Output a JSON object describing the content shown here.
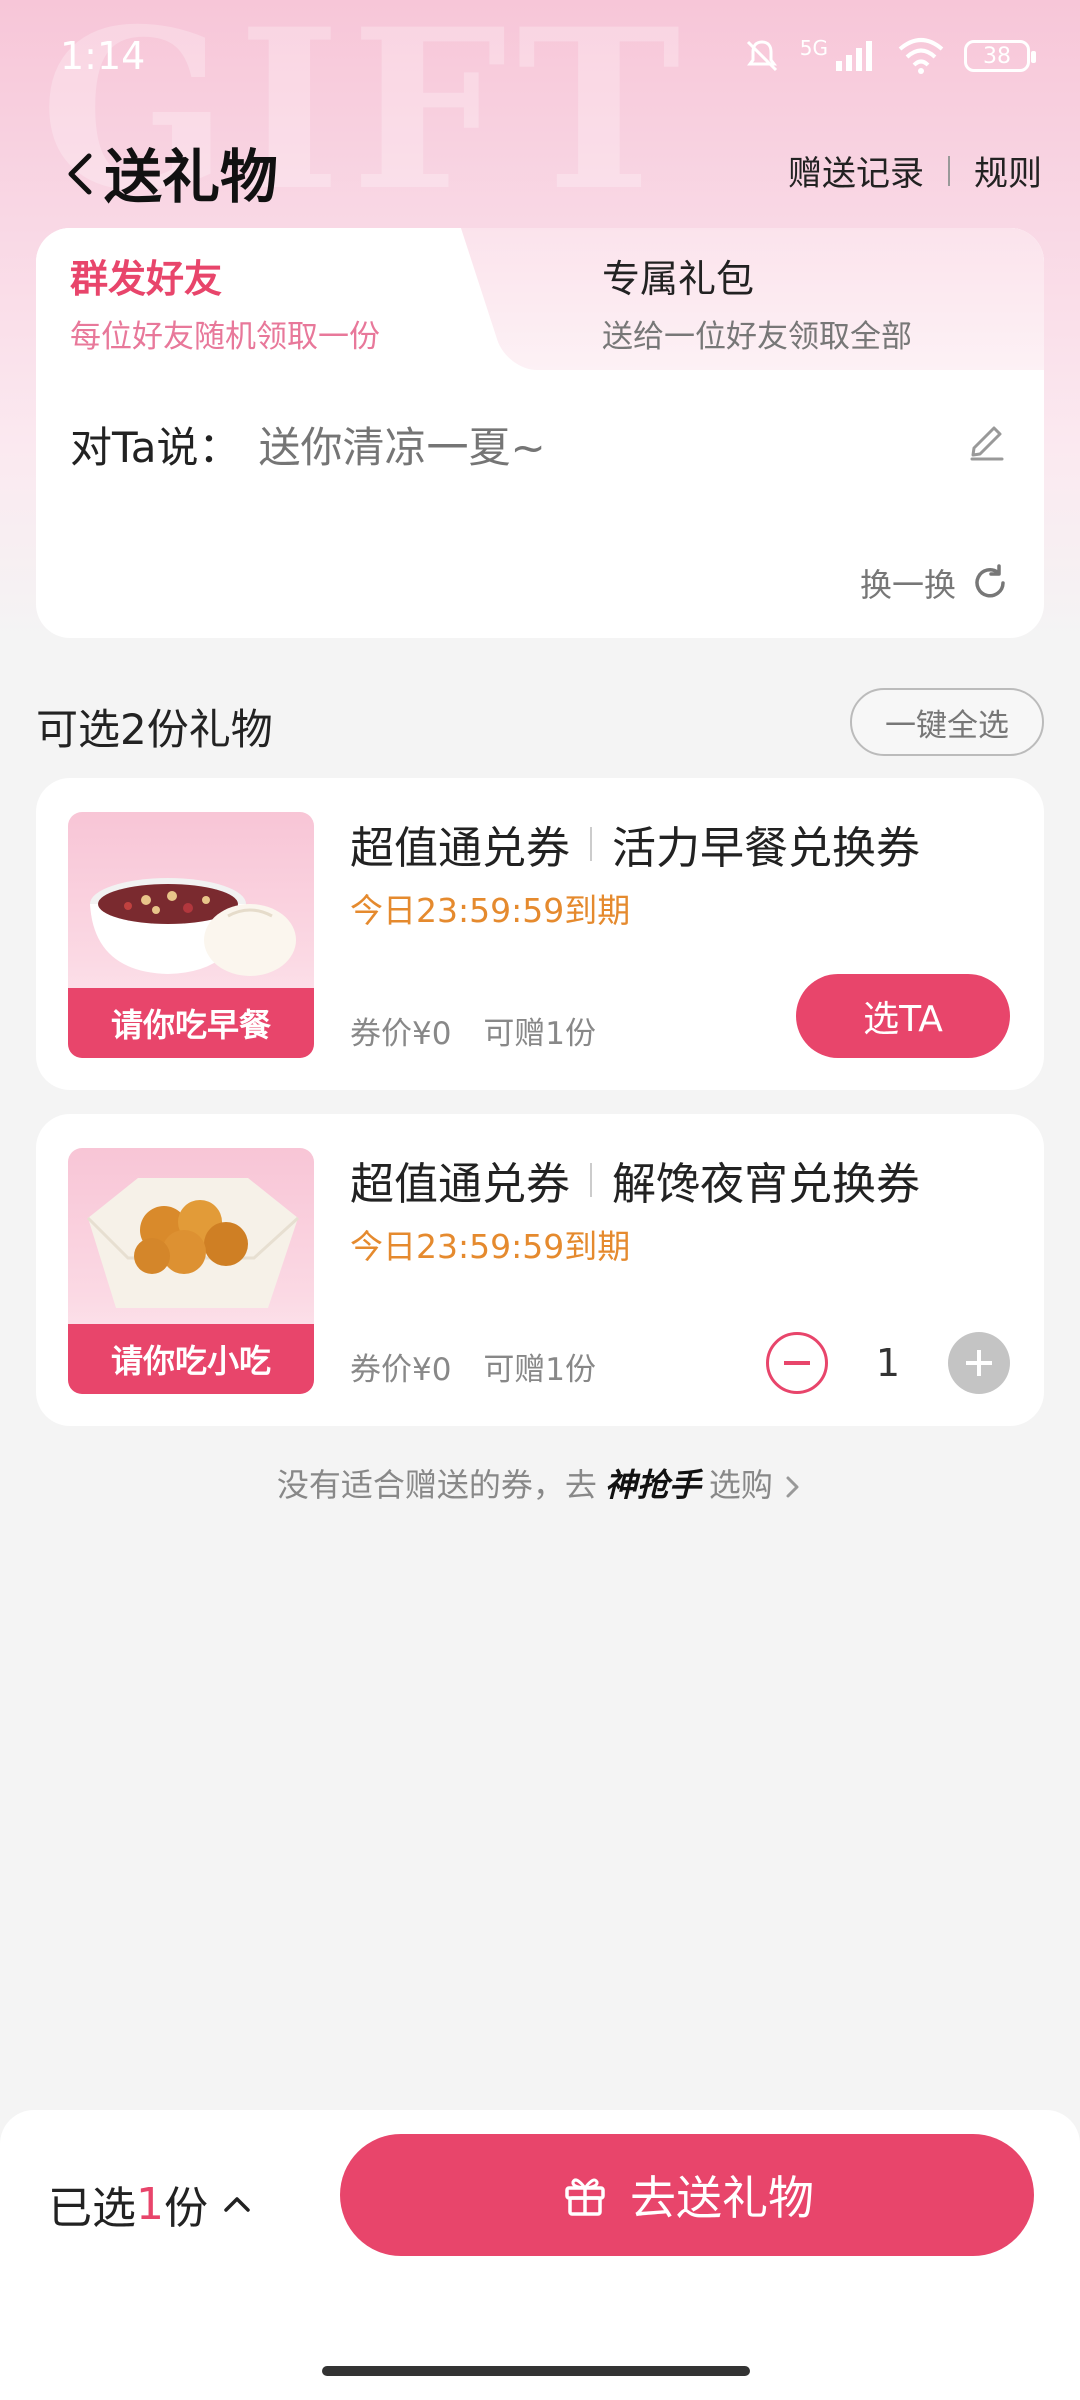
{
  "status_bar": {
    "time": "1:14",
    "network": "5G",
    "battery": "38"
  },
  "header": {
    "title": "送礼物",
    "record_label": "赠送记录",
    "rules_label": "规则"
  },
  "tabs": [
    {
      "title": "群发好友",
      "subtitle": "每位好友随机领取一份",
      "active": true
    },
    {
      "title": "专属礼包",
      "subtitle": "送给一位好友领取全部",
      "active": false
    }
  ],
  "message": {
    "label": "对Ta说：",
    "placeholder": "送你清凉一夏~",
    "refresh_label": "换一换"
  },
  "gifts_section": {
    "title": "可选2份礼物",
    "select_all_label": "一键全选"
  },
  "gifts": [
    {
      "image_caption": "请你吃早餐",
      "category": "超值通兑券",
      "name": "活力早餐兑换券",
      "expire": "今日23:59:59到期",
      "price": "券价¥0",
      "quota": "可赠1份",
      "action_label": "选TA"
    },
    {
      "image_caption": "请你吃小吃",
      "category": "超值通兑券",
      "name": "解馋夜宵兑换券",
      "expire": "今日23:59:59到期",
      "price": "券价¥0",
      "quota": "可赠1份",
      "quantity": "1"
    }
  ],
  "hint": {
    "prefix": "没有适合赠送的券，去",
    "brand": "神抢手",
    "suffix": "选购"
  },
  "bottom_bar": {
    "selected_prefix": "已选",
    "selected_count": "1",
    "selected_suffix": "份",
    "send_label": "去送礼物"
  },
  "colors": {
    "accent": "#e8456b",
    "expire": "#e58a2e"
  }
}
